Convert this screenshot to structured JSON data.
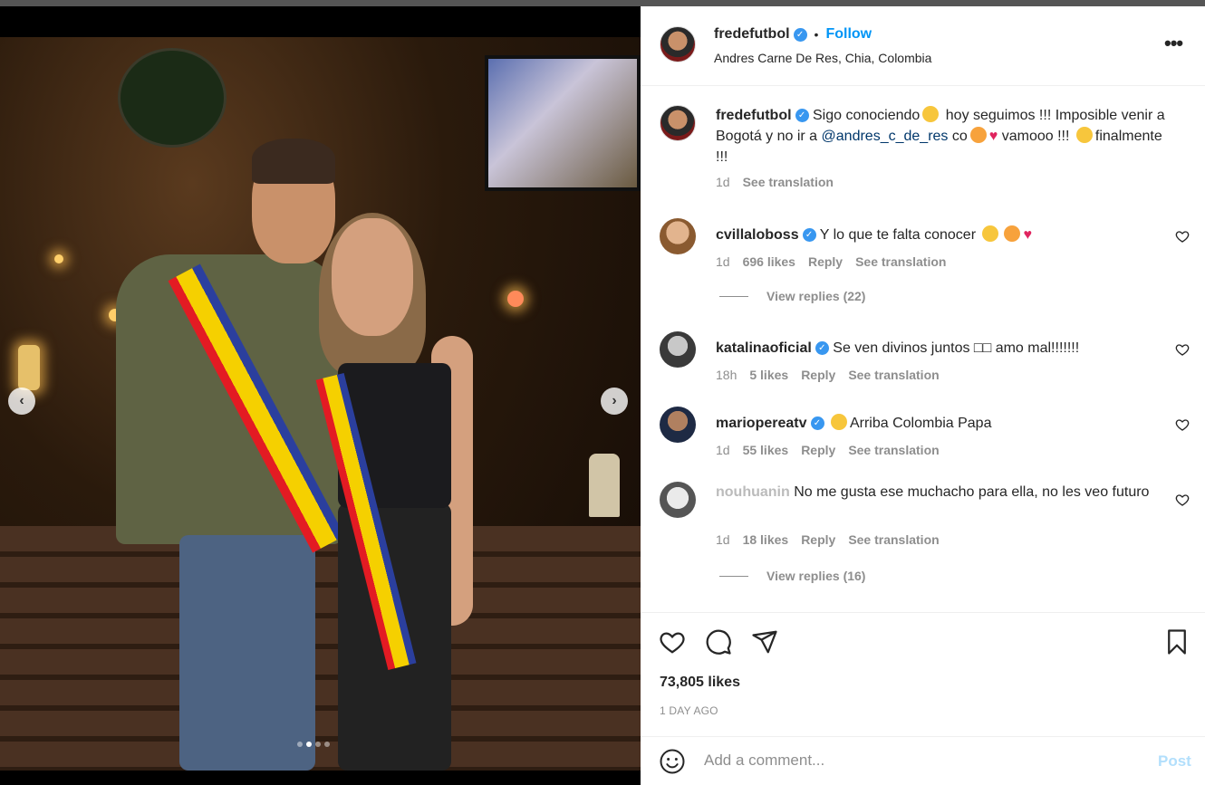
{
  "post": {
    "author": "fredefutbol",
    "follow_label": "Follow",
    "separator": "•",
    "location": "Andres Carne De Res, Chia, Colombia",
    "more_icon": "more-options-icon",
    "more_label": "•••"
  },
  "caption": {
    "author": "fredefutbol",
    "text_1": "Sigo conociendo",
    "text_2": "hoy seguimos !!! Imposible venir a Bogotá y no ir a",
    "mention": "@andres_c_de_res",
    "text_3": "co",
    "text_4": "vamooo !!!",
    "text_5": "finalmente !!!",
    "time": "1d",
    "translate": "See translation"
  },
  "comments": [
    {
      "user": "cvillaloboss",
      "verified": true,
      "text": "Y lo que te falta conocer",
      "time": "1d",
      "likes": "696 likes",
      "reply": "Reply",
      "translate": "See translation",
      "replies": "View replies (22)"
    },
    {
      "user": "katalinaoficial",
      "verified": true,
      "text": "Se ven divinos juntos □□ amo mal!!!!!!!",
      "time": "18h",
      "likes": "5 likes",
      "reply": "Reply",
      "translate": "See translation"
    },
    {
      "user": "marioperea tv",
      "display_user": "mariopereatv",
      "verified": true,
      "text": "Arriba Colombia Papa",
      "time": "1d",
      "likes": "55 likes",
      "reply": "Reply",
      "translate": "See translation"
    },
    {
      "user": "nouhuanin",
      "text": "No me gusta ese muchacho para ella, no les veo futuro",
      "time": "1d",
      "likes": "18 likes",
      "reply": "Reply",
      "translate": "See translation",
      "replies": "View replies (16)"
    }
  ],
  "actions": {
    "likes": "73,805 likes",
    "date": "1 DAY AGO"
  },
  "composer": {
    "placeholder": "Add a comment...",
    "post_label": "Post"
  },
  "carousel": {
    "prev": "‹",
    "next": "›",
    "total": 4,
    "current": 2
  },
  "colors": {
    "link": "#0095f6",
    "verified": "#3897f0",
    "post_disabled": "#b2dffc",
    "muted": "#8e8e8e"
  }
}
